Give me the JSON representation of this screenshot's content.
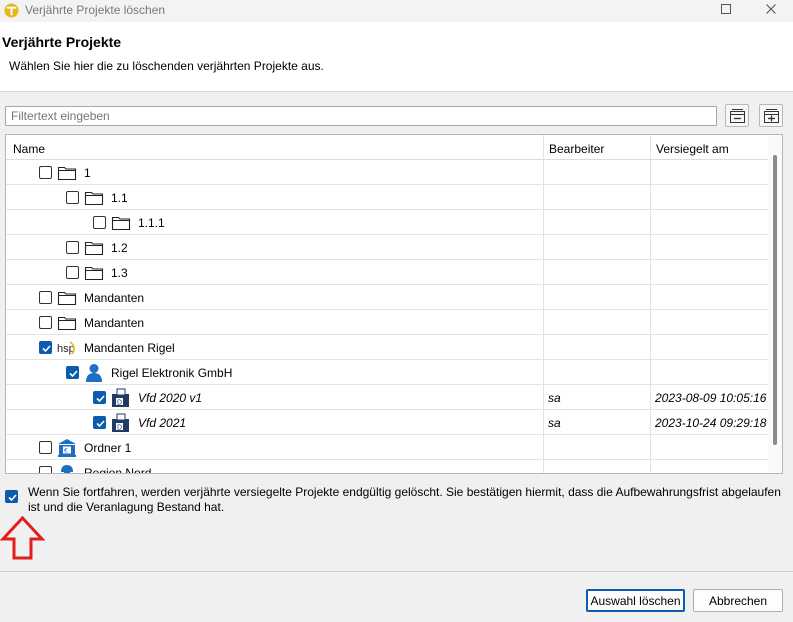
{
  "window": {
    "title": "Verjährte Projekte löschen"
  },
  "header": {
    "title": "Verjährte Projekte",
    "description": "Wählen Sie hier die zu löschenden verjährten Projekte aus."
  },
  "filter": {
    "placeholder": "Filtertext eingeben"
  },
  "table": {
    "columns": [
      "Name",
      "Bearbeiter",
      "Versiegelt am"
    ],
    "rows": [
      {
        "label": "1",
        "icon": "folder-icon",
        "checked": false,
        "bearbeiter": "",
        "versiegelt": ""
      },
      {
        "label": "1.1",
        "icon": "folder-icon",
        "checked": false,
        "bearbeiter": "",
        "versiegelt": ""
      },
      {
        "label": "1.1.1",
        "icon": "folder-icon",
        "checked": false,
        "bearbeiter": "",
        "versiegelt": ""
      },
      {
        "label": "1.2",
        "icon": "folder-icon",
        "checked": false,
        "bearbeiter": "",
        "versiegelt": ""
      },
      {
        "label": "1.3",
        "icon": "folder-icon",
        "checked": false,
        "bearbeiter": "",
        "versiegelt": ""
      },
      {
        "label": "Mandanten",
        "icon": "folder-icon",
        "checked": false,
        "bearbeiter": "",
        "versiegelt": ""
      },
      {
        "label": "Mandanten",
        "icon": "folder-icon",
        "checked": false,
        "bearbeiter": "",
        "versiegelt": ""
      },
      {
        "label": "Mandanten Rigel",
        "icon": "hsp-logo-icon",
        "icon_text": "hsp",
        "checked": true,
        "bearbeiter": "",
        "versiegelt": ""
      },
      {
        "label": "Rigel Elektronik GmbH",
        "icon": "person-icon",
        "checked": true,
        "bearbeiter": "",
        "versiegelt": ""
      },
      {
        "label": "Vfd 2020 v1",
        "icon": "sealed-project-icon",
        "checked": true,
        "bearbeiter": "sa",
        "versiegelt": "2023-08-09 10:05:16"
      },
      {
        "label": "Vfd 2021",
        "icon": "sealed-project-icon",
        "checked": true,
        "bearbeiter": "sa",
        "versiegelt": "2023-10-24 09:29:18"
      },
      {
        "label": "Ordner 1",
        "icon": "bank-icon",
        "checked": false,
        "bearbeiter": "",
        "versiegelt": ""
      },
      {
        "label": "Region Nord",
        "icon": "worker-icon",
        "checked": false,
        "bearbeiter": "",
        "versiegelt": ""
      }
    ]
  },
  "confirm": {
    "checked": true,
    "text": "Wenn Sie fortfahren, werden verjährte versiegelte Projekte endgültig gelöscht. Sie bestätigen hiermit, dass die Aufbewahrungsfrist abgelaufen ist und die Veranlagung Bestand hat."
  },
  "buttons": {
    "delete": "Auswahl löschen",
    "cancel": "Abbrechen"
  },
  "colors": {
    "accent": "#0b5cad",
    "arrow": "#e01e1e",
    "app_icon": "#e5b81c"
  }
}
